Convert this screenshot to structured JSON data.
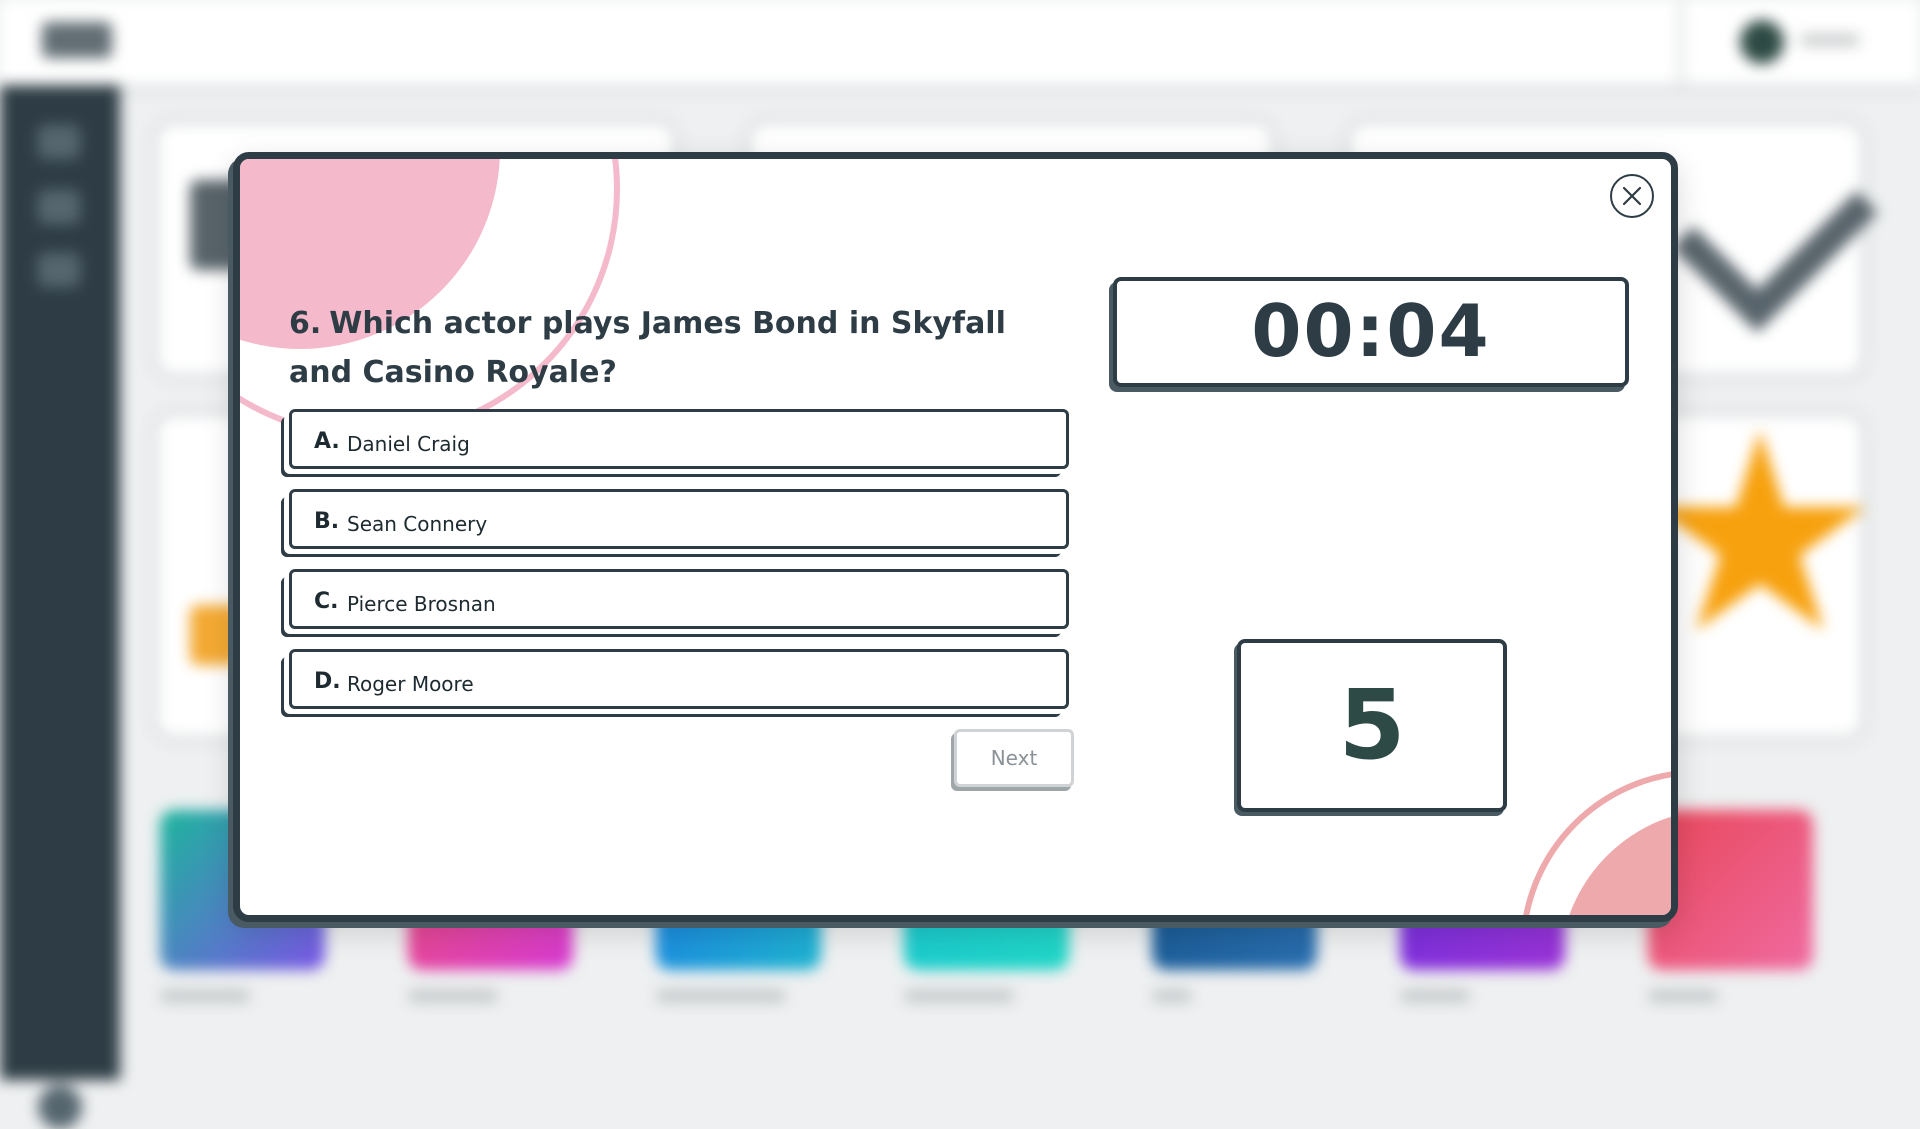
{
  "window": {
    "background_app": "quiz-dashboard",
    "overlay": "quiz-dialog"
  },
  "quiz": {
    "question_number": "6.",
    "question_text": "Which actor plays James Bond in Skyfall and Casino Royale?",
    "answers": [
      {
        "letter": "A.",
        "text": "Daniel Craig"
      },
      {
        "letter": "B.",
        "text": "Sean Connery"
      },
      {
        "letter": "C.",
        "text": "Pierce Brosnan"
      },
      {
        "letter": "D.",
        "text": "Roger Moore"
      }
    ],
    "next_label": "Next",
    "timer": "00:04",
    "score": "5",
    "close_icon": "close-icon"
  },
  "colors": {
    "dark": "#2e3d45",
    "accent_pink": "#f4b9cb",
    "accent_rose": "#eea9ac",
    "score_text": "#2e4a46",
    "next_disabled": "#8a9297"
  }
}
